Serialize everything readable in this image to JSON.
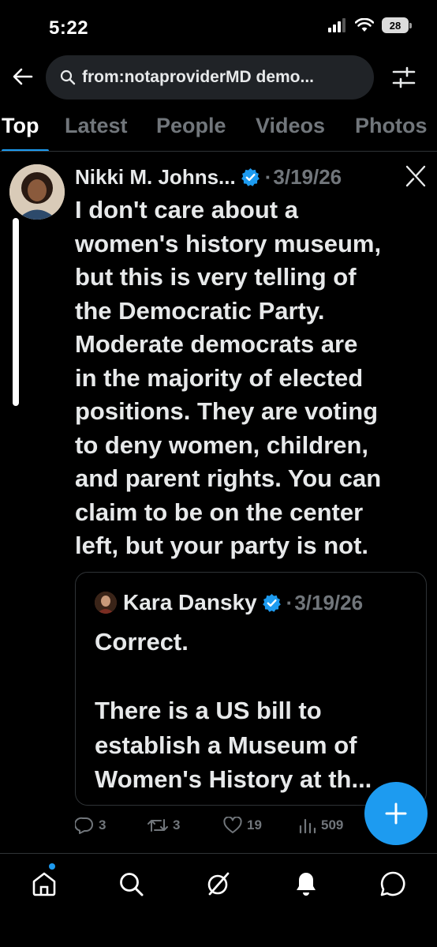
{
  "status_bar": {
    "time": "5:22",
    "battery": "28"
  },
  "search": {
    "query": "from:notaproviderMD demo..."
  },
  "tabs": [
    {
      "label": "Top",
      "active": true
    },
    {
      "label": "Latest",
      "active": false
    },
    {
      "label": "People",
      "active": false
    },
    {
      "label": "Videos",
      "active": false
    },
    {
      "label": "Photos",
      "active": false
    }
  ],
  "tweet": {
    "author": "Nikki M. Johns...",
    "separator": "·",
    "date": "3/19/26",
    "text": "I don't care about a\nwomen's history museum,\nbut this is very telling of\nthe Democratic Party.\nModerate democrats are\nin the majority of elected\npositions. They are voting\nto deny women, children,\nand parent rights. You can\nclaim to be on the center\nleft, but your party is not.",
    "quote": {
      "author": "Kara Dansky",
      "separator": "·",
      "date": "3/19/26",
      "text": "Correct.\n\nThere is a US bill to\nestablish a Museum of\nWomen's History at th..."
    },
    "actions": {
      "replies": "3",
      "reposts": "3",
      "likes": "19",
      "views": "509"
    }
  },
  "colors": {
    "accent": "#1d9bf0",
    "muted": "#71767b",
    "text": "#e7e9ea",
    "background": "#000000"
  },
  "icons": [
    "back-arrow-icon",
    "search-icon",
    "filter-icon",
    "verified-icon",
    "grok-icon",
    "reply-icon",
    "repost-icon",
    "like-icon",
    "views-icon",
    "compose-icon",
    "home-icon",
    "explore-icon",
    "grok-nav-icon",
    "notifications-icon",
    "messages-icon"
  ]
}
